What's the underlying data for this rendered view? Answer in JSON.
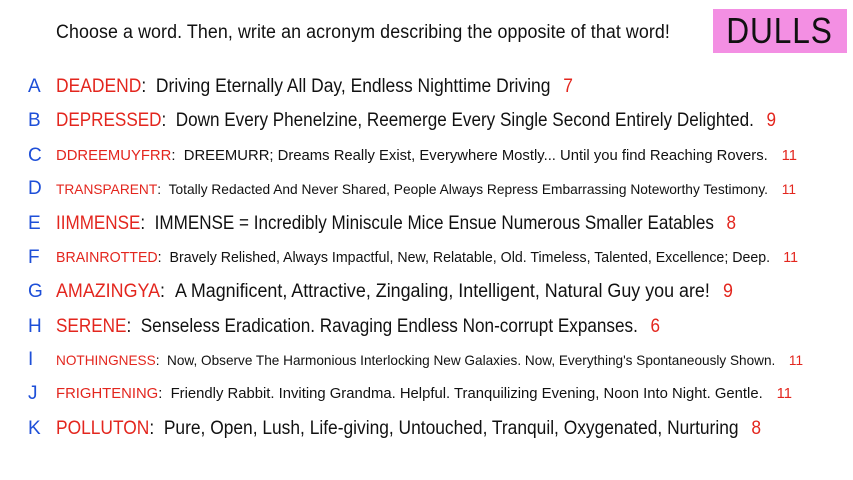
{
  "header": {
    "prompt": "Choose a word. Then, write an acronym describing the opposite of that word!",
    "title": "DULLS",
    "title_bg": "#f38fe3"
  },
  "colors": {
    "letter": "#1e4fd8",
    "word": "#e3261e",
    "count": "#e3261e",
    "text": "#111111"
  },
  "rows": [
    {
      "letter": "A",
      "word": "DEADEND",
      "definition": "Driving Eternally All Day, Endless Nighttime Driving",
      "count": "7"
    },
    {
      "letter": "B",
      "word": "DEPRESSED",
      "definition": "Down Every Phenelzine, Reemerge Every Single Second Entirely Delighted.",
      "count": "9"
    },
    {
      "letter": "C",
      "word": "DDREEMUYFRR",
      "definition": "DREEMURR; Dreams Really Exist, Everywhere Mostly... Until you find Reaching Rovers.",
      "count": "11"
    },
    {
      "letter": "D",
      "word": "TRANSPARENT",
      "definition": "Totally Redacted And Never Shared, People Always Repress Embarrassing Noteworthy Testimony.",
      "count": "11"
    },
    {
      "letter": "E",
      "word": "IIMMENSE",
      "definition": "IMMENSE = Incredibly Miniscule Mice Ensue Numerous Smaller Eatables",
      "count": "8"
    },
    {
      "letter": "F",
      "word": "BRAINROTTED",
      "definition": "Bravely Relished, Always Impactful, New, Relatable, Old. Timeless, Talented, Excellence; Deep.",
      "count": "11"
    },
    {
      "letter": "G",
      "word": "AMAZINGYA",
      "definition": "A Magnificent, Attractive, Zingaling, Intelligent, Natural Guy you are!",
      "count": "9"
    },
    {
      "letter": "H",
      "word": "SERENE",
      "definition": "Senseless Eradication. Ravaging Endless Non-corrupt Expanses.",
      "count": "6"
    },
    {
      "letter": "I",
      "word": "NOTHINGNESS",
      "definition": "Now, Observe The Harmonious Interlocking New Galaxies. Now, Everything's Spontaneously Shown.",
      "count": "11"
    },
    {
      "letter": "J",
      "word": "FRIGHTENING",
      "definition": "Friendly Rabbit. Inviting Grandma. Helpful. Tranquilizing Evening, Noon Into Night. Gentle.",
      "count": "11"
    },
    {
      "letter": "K",
      "word": "POLLUTON",
      "definition": "Pure, Open, Lush, Life-giving, Untouched, Tranquil, Oxygenated, Nurturing",
      "count": "8"
    }
  ]
}
